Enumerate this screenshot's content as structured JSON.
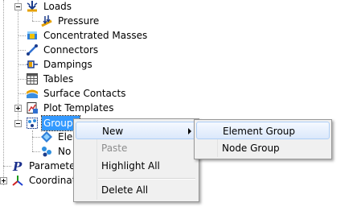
{
  "tree": {
    "loads": {
      "label": "Loads",
      "icon": "loads-icon"
    },
    "pressure": {
      "label": "Pressure",
      "icon": "pressure-icon"
    },
    "concentrated_masses": {
      "label": "Concentrated Masses",
      "icon": "concentrated-masses-icon"
    },
    "connectors": {
      "label": "Connectors",
      "icon": "connectors-icon"
    },
    "dampings": {
      "label": "Dampings",
      "icon": "dampings-icon"
    },
    "tables": {
      "label": "Tables",
      "icon": "tables-icon"
    },
    "surface_contacts": {
      "label": "Surface Contacts",
      "icon": "surface-contacts-icon"
    },
    "plot_templates": {
      "label": "Plot Templates",
      "icon": "plot-templates-icon"
    },
    "groups": {
      "label": "Groups",
      "icon": "groups-icon"
    },
    "element_groups": {
      "label": "Elem",
      "icon": "element-group-icon"
    },
    "node_groups": {
      "label": "No",
      "icon": "node-group-icon"
    },
    "parameters": {
      "label": "Parameter",
      "icon": "parameters-icon"
    },
    "coordinates": {
      "label": "Coordinate",
      "icon": "coordinates-icon"
    }
  },
  "context_menu": {
    "new": "New",
    "paste": "Paste",
    "highlight_all": "Highlight All",
    "delete_all": "Delete All"
  },
  "submenu": {
    "element_group": "Element Group",
    "node_group": "Node Group"
  }
}
